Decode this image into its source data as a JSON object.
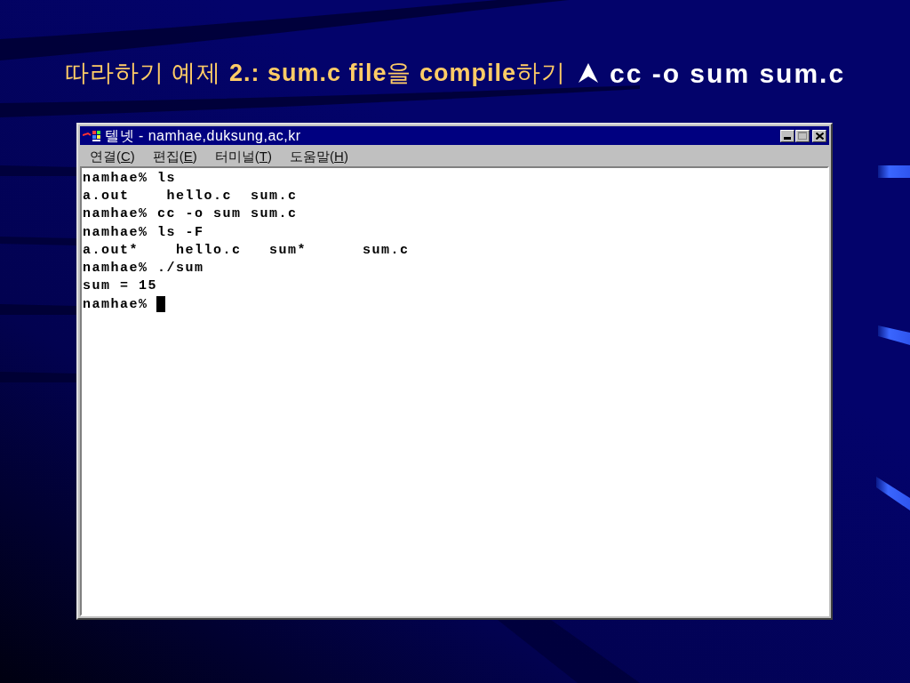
{
  "slide": {
    "title": "따라하기 예제 **2.: sum.c file**을 **compile**하기",
    "command": "cc -o sum sum.c"
  },
  "window": {
    "title": "텔넷 - namhae,duksung,ac,kr",
    "controls": [
      {
        "kind": "minimize",
        "disabled": false
      },
      {
        "kind": "maximize",
        "disabled": true
      },
      {
        "kind": "close",
        "disabled": false
      }
    ]
  },
  "menu": [
    {
      "before": "연결(",
      "mnemonic": "C",
      "after": ")"
    },
    {
      "before": "편집(",
      "mnemonic": "E",
      "after": ")"
    },
    {
      "before": "터미널(",
      "mnemonic": "T",
      "after": ")"
    },
    {
      "before": "도움말(",
      "mnemonic": "H",
      "after": ")"
    }
  ],
  "terminal": {
    "lines": [
      "namhae% ls",
      "a.out    hello.c  sum.c",
      "namhae% cc -o sum sum.c",
      "namhae% ls -F",
      "a.out*    hello.c   sum*      sum.c",
      "namhae% ./sum",
      "sum = 15",
      "namhae%"
    ],
    "cursor": true
  }
}
